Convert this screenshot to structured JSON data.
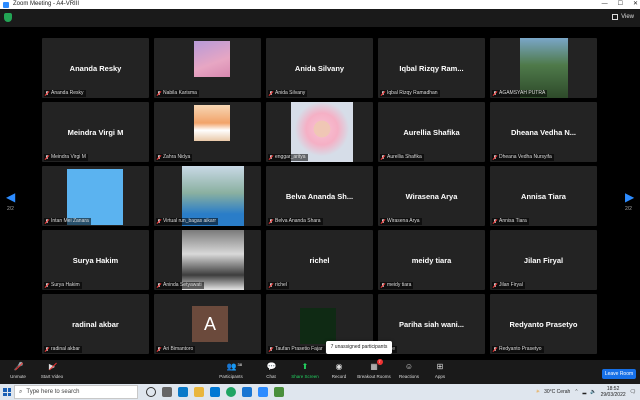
{
  "window": {
    "title": "Zoom Meeting - A4-VRIII",
    "controls": [
      "—",
      "☐",
      "✕"
    ]
  },
  "topbar": {
    "view_label": "View"
  },
  "page_indicator": {
    "left": "2/2",
    "right": "2/2"
  },
  "tiles": [
    {
      "big": "Ananda Resky",
      "label": "Ananda Resky"
    },
    {
      "big": "",
      "label": "Nabila Karisma",
      "pic": "pink-sky"
    },
    {
      "big": "Anida Silvany",
      "label": "Anida Silvany"
    },
    {
      "big": "Iqbal Rizqy Ram...",
      "label": "Iqbal Rizqy Ramadhan"
    },
    {
      "big": "",
      "label": "AGAMSYAH PUTRA",
      "pic": "forest"
    },
    {
      "big": "Meindra Virgi M",
      "label": "Meindra Virgi M"
    },
    {
      "big": "",
      "label": "Zahra Nidya",
      "pic": "sunset"
    },
    {
      "big": "",
      "label": "enggar_aritya",
      "pic": "portrait"
    },
    {
      "big": "Aurellia Shafika",
      "label": "Aurellia Shafika"
    },
    {
      "big": "Dheana Vedha N...",
      "label": "Dheana Vedha Nursyifa"
    },
    {
      "big": "",
      "label": "Intan Mei Zanara",
      "pic": "blue"
    },
    {
      "big": "",
      "label": "Virtual run_bagas aikarr",
      "pic": "field"
    },
    {
      "big": "Belva Ananda Sh...",
      "label": "Belva Ananda Shara"
    },
    {
      "big": "Wirasena Arya",
      "label": "Wirasena Arya"
    },
    {
      "big": "Annisa Tiara",
      "label": "Annisa Tiara"
    },
    {
      "big": "Surya Hakim",
      "label": "Surya Hakim"
    },
    {
      "big": "",
      "label": "Aninda Setyawati",
      "pic": "stairs"
    },
    {
      "big": "richel",
      "label": "richel"
    },
    {
      "big": "meidy tiara",
      "label": "meidy tiara"
    },
    {
      "big": "Jilan Firyal",
      "label": "Jilan Firyal"
    },
    {
      "big": "radinal akbar",
      "label": "radinal akbar"
    },
    {
      "big": "",
      "label": "Ari Bimantoro",
      "pic": "avatar-a"
    },
    {
      "big": "",
      "label": "Taufan Prasetio Fajar",
      "pic": "dark-green"
    },
    {
      "big": "Pariha siah wani...",
      "label": "...ie"
    },
    {
      "big": "Redyanto Prasetyo",
      "label": "Redyanto Prasetyo"
    }
  ],
  "avatar_letter": "A",
  "popup": {
    "text": "7 unassigned participants"
  },
  "toolbar": {
    "unmute": "Unmute",
    "start_video": "Start Video",
    "participants": "Participants",
    "participants_count": "38",
    "chat": "Chat",
    "share_screen": "Share Screen",
    "record": "Record",
    "breakout_rooms": "Breakout Rooms",
    "breakout_badge": "7",
    "reactions": "Reactions",
    "apps": "Apps",
    "leave": "Leave Room"
  },
  "taskbar": {
    "search_placeholder": "Type here to search",
    "weather": "30°C Cerah",
    "time": "18:52",
    "date": "29/03/2022"
  }
}
